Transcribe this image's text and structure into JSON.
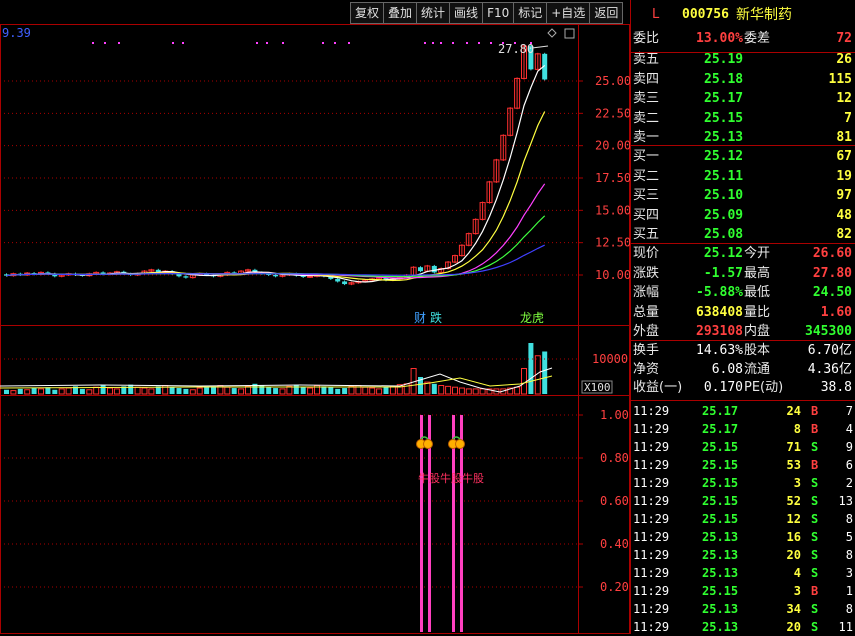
{
  "toolbar": {
    "buttons": [
      "复权",
      "叠加",
      "统计",
      "画线",
      "F10",
      "标记",
      "+自选",
      "返回"
    ]
  },
  "chart": {
    "corner_value": "9.39",
    "high_label": "27.80",
    "price_ticks": [
      "25.00",
      "22.50",
      "20.00",
      "17.50",
      "15.00",
      "12.50",
      "10.00"
    ],
    "volume_tick": "10000",
    "volume_unit": "X100",
    "indicator_ticks": [
      "1.00",
      "0.80",
      "0.60",
      "0.40",
      "0.20"
    ],
    "event_labels": [
      "财",
      "跌",
      "龙虎"
    ],
    "indicator_text": "牛股牛股牛股",
    "candles": [
      [
        10.05,
        9.95
      ],
      [
        9.95,
        10.1
      ],
      [
        10.1,
        10.0
      ],
      [
        10.0,
        10.15
      ],
      [
        10.15,
        10.05
      ],
      [
        10.05,
        10.2
      ],
      [
        10.2,
        10.1
      ],
      [
        10.1,
        9.9
      ],
      [
        9.9,
        10.0
      ],
      [
        10.0,
        10.1
      ],
      [
        10.1,
        10.0
      ],
      [
        10.0,
        9.95
      ],
      [
        9.95,
        10.1
      ],
      [
        10.1,
        10.2
      ],
      [
        10.2,
        10.05
      ],
      [
        10.05,
        10.15
      ],
      [
        10.15,
        10.25
      ],
      [
        10.25,
        10.1
      ],
      [
        10.1,
        10.0
      ],
      [
        10.0,
        10.1
      ],
      [
        10.1,
        10.3
      ],
      [
        10.3,
        10.4
      ],
      [
        10.4,
        10.2
      ],
      [
        10.2,
        10.3
      ],
      [
        10.3,
        10.1
      ],
      [
        10.1,
        9.9
      ],
      [
        9.9,
        9.8
      ],
      [
        9.8,
        10.0
      ],
      [
        10.0,
        10.1
      ],
      [
        10.1,
        10.0
      ],
      [
        10.0,
        9.9
      ],
      [
        9.9,
        10.0
      ],
      [
        10.0,
        10.2
      ],
      [
        10.2,
        10.1
      ],
      [
        10.1,
        10.3
      ],
      [
        10.3,
        10.4
      ],
      [
        10.4,
        10.2
      ],
      [
        10.2,
        10.1
      ],
      [
        10.1,
        10.0
      ],
      [
        10.0,
        9.9
      ],
      [
        9.9,
        10.0
      ],
      [
        10.0,
        10.1
      ],
      [
        10.1,
        9.95
      ],
      [
        9.95,
        9.85
      ],
      [
        9.85,
        9.9
      ],
      [
        9.9,
        10.0
      ],
      [
        10.0,
        9.9
      ],
      [
        9.9,
        9.7
      ],
      [
        9.7,
        9.5
      ],
      [
        9.5,
        9.3
      ],
      [
        9.3,
        9.4
      ],
      [
        9.4,
        9.5
      ],
      [
        9.5,
        9.6
      ],
      [
        9.6,
        9.7
      ],
      [
        9.7,
        9.8
      ],
      [
        9.8,
        9.6
      ],
      [
        9.6,
        9.7
      ],
      [
        9.7,
        9.8
      ],
      [
        9.8,
        10.0
      ],
      [
        10.0,
        10.6
      ],
      [
        10.6,
        10.3
      ],
      [
        10.3,
        10.7
      ],
      [
        10.7,
        10.2
      ],
      [
        10.2,
        10.5
      ],
      [
        10.5,
        11.0
      ],
      [
        11.0,
        11.5
      ],
      [
        11.5,
        12.3
      ],
      [
        12.3,
        13.2
      ],
      [
        13.2,
        14.3
      ],
      [
        14.3,
        15.6
      ],
      [
        15.6,
        17.2
      ],
      [
        17.2,
        18.9
      ],
      [
        18.9,
        20.8
      ],
      [
        20.8,
        22.9
      ],
      [
        22.9,
        25.2
      ],
      [
        25.2,
        27.7
      ],
      [
        27.7,
        25.9
      ],
      [
        25.9,
        27.1
      ],
      [
        27.1,
        25.12
      ]
    ],
    "volumes": [
      5,
      4,
      6,
      5,
      7,
      6,
      8,
      5,
      6,
      7,
      9,
      6,
      5,
      8,
      10,
      7,
      6,
      9,
      11,
      8,
      7,
      6,
      9,
      10,
      8,
      7,
      6,
      5,
      7,
      8,
      9,
      10,
      8,
      7,
      6,
      9,
      12,
      10,
      8,
      7,
      6,
      9,
      11,
      8,
      7,
      10,
      9,
      8,
      6,
      7,
      9,
      10,
      8,
      7,
      6,
      8,
      9,
      11,
      12,
      30,
      20,
      14,
      12,
      10,
      9,
      8,
      7,
      6,
      6,
      6,
      6,
      6,
      6,
      7,
      8,
      30,
      60,
      45,
      50,
      30
    ]
  },
  "quote": {
    "type_letter": "L",
    "code": "000756",
    "name": "新华制药",
    "wei_bi_label": "委比",
    "wei_bi": "13.00%",
    "wei_cha_label": "委差",
    "wei_cha": "72",
    "asks": [
      {
        "label": "卖五",
        "price": "25.19",
        "vol": "26"
      },
      {
        "label": "卖四",
        "price": "25.18",
        "vol": "115"
      },
      {
        "label": "卖三",
        "price": "25.17",
        "vol": "12"
      },
      {
        "label": "卖二",
        "price": "25.15",
        "vol": "7"
      },
      {
        "label": "卖一",
        "price": "25.13",
        "vol": "81"
      }
    ],
    "bids": [
      {
        "label": "买一",
        "price": "25.12",
        "vol": "67"
      },
      {
        "label": "买二",
        "price": "25.11",
        "vol": "19"
      },
      {
        "label": "买三",
        "price": "25.10",
        "vol": "97"
      },
      {
        "label": "买四",
        "price": "25.09",
        "vol": "48"
      },
      {
        "label": "买五",
        "price": "25.08",
        "vol": "82"
      }
    ],
    "stats": [
      {
        "l1": "现价",
        "v1": "25.12",
        "c1": "green",
        "l2": "今开",
        "v2": "26.60",
        "c2": "red"
      },
      {
        "l1": "涨跌",
        "v1": "-1.57",
        "c1": "green",
        "l2": "最高",
        "v2": "27.80",
        "c2": "red"
      },
      {
        "l1": "涨幅",
        "v1": "-5.88%",
        "c1": "green",
        "l2": "最低",
        "v2": "24.50",
        "c2": "green"
      },
      {
        "l1": "总量",
        "v1": "638408",
        "c1": "yellow",
        "l2": "量比",
        "v2": "1.60",
        "c2": "red"
      },
      {
        "l1": "外盘",
        "v1": "293108",
        "c1": "red",
        "l2": "内盘",
        "v2": "345300",
        "c2": "green"
      }
    ],
    "fund": [
      {
        "l1": "换手",
        "v1": "14.63%",
        "l2": "股本",
        "v2": "6.70亿"
      },
      {
        "l1": "净资",
        "v1": "6.08",
        "l2": "流通",
        "v2": "4.36亿"
      },
      {
        "l1": "收益(一)",
        "v1": "0.170",
        "l2": "PE(动)",
        "v2": "38.8"
      }
    ],
    "ticks": [
      {
        "time": "11:29",
        "price": "25.17",
        "vol": "24",
        "side": "B",
        "n": "7"
      },
      {
        "time": "11:29",
        "price": "25.17",
        "vol": "8",
        "side": "B",
        "n": "4"
      },
      {
        "time": "11:29",
        "price": "25.15",
        "vol": "71",
        "side": "S",
        "n": "9"
      },
      {
        "time": "11:29",
        "price": "25.15",
        "vol": "53",
        "side": "B",
        "n": "6"
      },
      {
        "time": "11:29",
        "price": "25.15",
        "vol": "3",
        "side": "S",
        "n": "2"
      },
      {
        "time": "11:29",
        "price": "25.15",
        "vol": "52",
        "side": "S",
        "n": "13"
      },
      {
        "time": "11:29",
        "price": "25.15",
        "vol": "12",
        "side": "S",
        "n": "8"
      },
      {
        "time": "11:29",
        "price": "25.13",
        "vol": "16",
        "side": "S",
        "n": "5"
      },
      {
        "time": "11:29",
        "price": "25.13",
        "vol": "20",
        "side": "S",
        "n": "8"
      },
      {
        "time": "11:29",
        "price": "25.13",
        "vol": "4",
        "side": "S",
        "n": "3"
      },
      {
        "time": "11:29",
        "price": "25.15",
        "vol": "3",
        "side": "B",
        "n": "1"
      },
      {
        "time": "11:29",
        "price": "25.13",
        "vol": "34",
        "side": "S",
        "n": "8"
      },
      {
        "time": "11:29",
        "price": "25.13",
        "vol": "20",
        "side": "S",
        "n": "11"
      }
    ]
  },
  "colors": {
    "up": "#ff3030",
    "down": "#40e0e0",
    "ma_white": "#ffffff",
    "ma_yellow": "#ffff40",
    "ma_magenta": "#ff40ff",
    "ma_green": "#40ff40",
    "ma_blue": "#4040ff",
    "grid": "#aa0000",
    "signal": "#ff40c0"
  }
}
